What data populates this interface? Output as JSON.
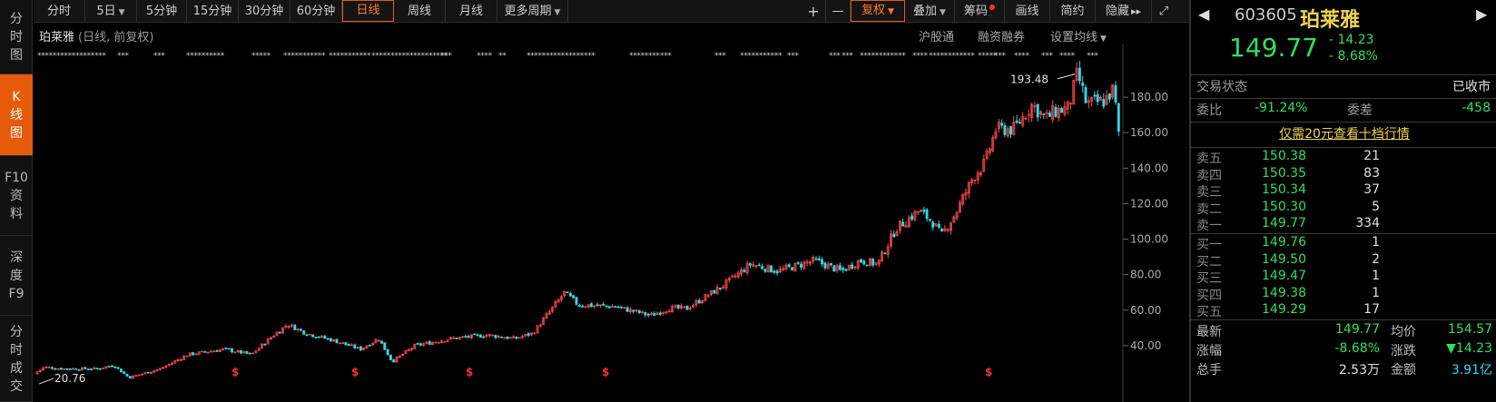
{
  "left_tabs": [
    {
      "label": "分\n时\n图",
      "active": false
    },
    {
      "label": "K\n线\n图",
      "active": true
    },
    {
      "label": "F10\n资\n料",
      "active": false
    },
    {
      "label": "深\n度\nF9",
      "active": false
    },
    {
      "label": "分\n时\n成\n交",
      "active": false
    }
  ],
  "toolbar": {
    "periods": [
      "分时",
      "5日",
      "5分钟",
      "15分钟",
      "30分钟",
      "60分钟",
      "日线",
      "周线",
      "月线",
      "更多周期"
    ],
    "active_period": "日线",
    "plus": "+",
    "minus": "—",
    "fuquan": "复权",
    "overlay": "叠加",
    "chips": "筹码",
    "draw": "画线",
    "simple": "简约",
    "hide": "隐藏",
    "collapse_icon": "▸▸",
    "expand_icon": "⤢"
  },
  "chart_header": {
    "stock_name": "珀莱雅",
    "mode": "(日线, 前复权)",
    "hgt": "沪股通",
    "margin": "融资融券",
    "ma_setting": "设置均线"
  },
  "chart_data": {
    "type": "candlestick",
    "y_ticks": [
      "180.00",
      "160.00",
      "140.00",
      "120.00",
      "100.00",
      "80.00",
      "60.00",
      "40.00"
    ],
    "high_label": "193.48",
    "low_label": "20.76",
    "dividend_marker": "$",
    "colors": {
      "up": "#ff4a4a",
      "down": "#35d6e6"
    }
  },
  "panel": {
    "code": "603605",
    "name": "珀莱雅",
    "price": "149.77",
    "change": "- 14.23",
    "change_pct": "- 8.68%",
    "trade_status_label": "交易状态",
    "trade_status": "已收市",
    "wei_bi_label": "委比",
    "wei_bi": "-91.24%",
    "wei_cha_label": "委差",
    "wei_cha": "-458",
    "ten_level_link": "仅需20元查看十档行情",
    "asks": [
      {
        "label": "卖五",
        "price": "150.38",
        "vol": "21"
      },
      {
        "label": "卖四",
        "price": "150.35",
        "vol": "83"
      },
      {
        "label": "卖三",
        "price": "150.34",
        "vol": "37"
      },
      {
        "label": "卖二",
        "price": "150.30",
        "vol": "5"
      },
      {
        "label": "卖一",
        "price": "149.77",
        "vol": "334"
      }
    ],
    "bids": [
      {
        "label": "买一",
        "price": "149.76",
        "vol": "1"
      },
      {
        "label": "买二",
        "price": "149.50",
        "vol": "2"
      },
      {
        "label": "买三",
        "price": "149.47",
        "vol": "1"
      },
      {
        "label": "买四",
        "price": "149.38",
        "vol": "1"
      },
      {
        "label": "买五",
        "price": "149.29",
        "vol": "17"
      }
    ],
    "stats": [
      {
        "l1": "最新",
        "v1": "149.77",
        "l2": "均价",
        "v2": "154.57"
      },
      {
        "l1": "涨幅",
        "v1": "-8.68%",
        "l2": "涨跌",
        "v2": "▼14.23"
      },
      {
        "l1": "总手",
        "v1": "2.53万",
        "l2": "金额",
        "v2": "3.91亿"
      }
    ]
  }
}
